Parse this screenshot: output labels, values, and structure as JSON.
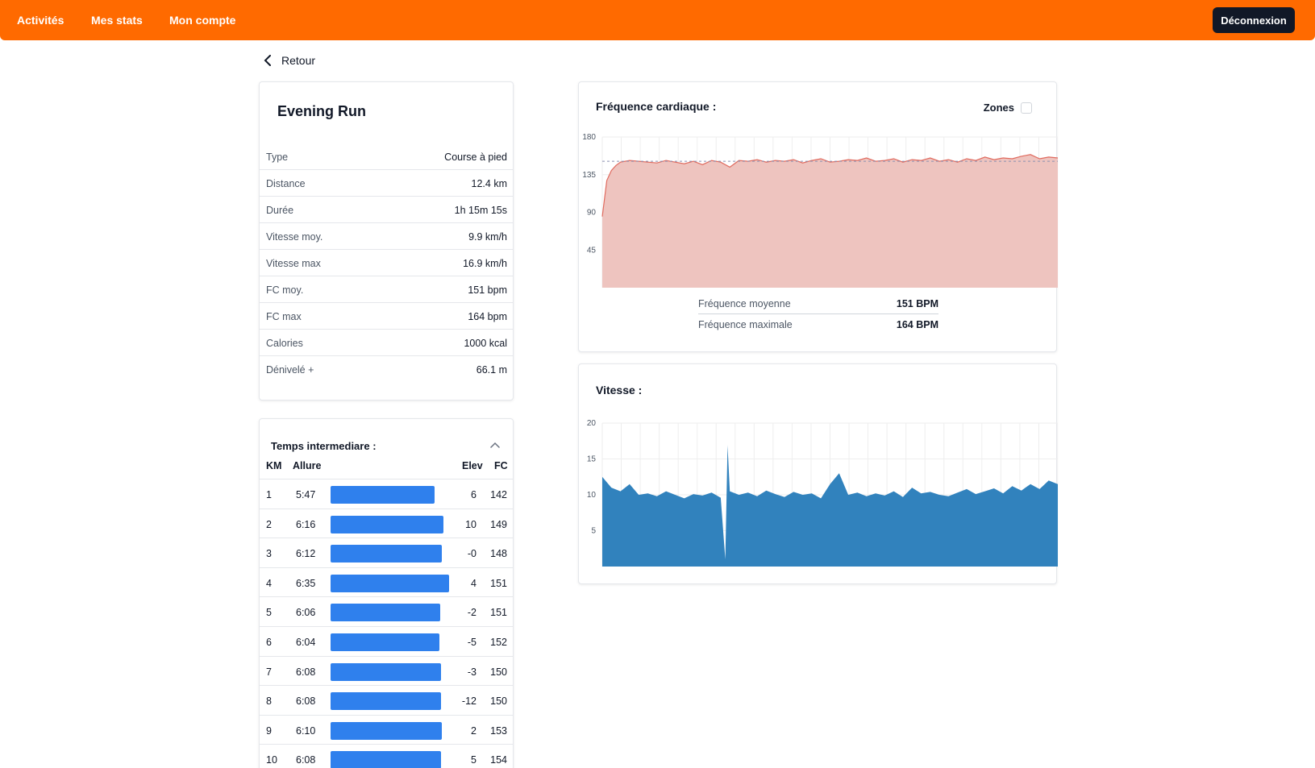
{
  "nav": {
    "links": [
      "Activités",
      "Mes stats",
      "Mon compte"
    ],
    "logout_label": "Déconnexion"
  },
  "back_label": "Retour",
  "activity": {
    "title": "Evening Run",
    "stats": [
      {
        "label": "Type",
        "value": "Course à pied"
      },
      {
        "label": "Distance",
        "value": "12.4 km"
      },
      {
        "label": "Durée",
        "value": "1h 15m 15s"
      },
      {
        "label": "Vitesse moy.",
        "value": "9.9 km/h"
      },
      {
        "label": "Vitesse max",
        "value": "16.9 km/h"
      },
      {
        "label": "FC moy.",
        "value": "151 bpm"
      },
      {
        "label": "FC max",
        "value": "164 bpm"
      },
      {
        "label": "Calories",
        "value": "1000 kcal"
      },
      {
        "label": "Dénivelé +",
        "value": "66.1 m"
      }
    ]
  },
  "splits": {
    "title": "Temps intermediare :",
    "headers": {
      "km": "KM",
      "pace": "Allure",
      "elev": "Elev",
      "hr": "FC"
    },
    "rows": [
      {
        "km": "1",
        "pace": "5:47",
        "elev": "6",
        "hr": "142",
        "pace_sec": 347
      },
      {
        "km": "2",
        "pace": "6:16",
        "elev": "10",
        "hr": "149",
        "pace_sec": 376
      },
      {
        "km": "3",
        "pace": "6:12",
        "elev": "-0",
        "hr": "148",
        "pace_sec": 372
      },
      {
        "km": "4",
        "pace": "6:35",
        "elev": "4",
        "hr": "151",
        "pace_sec": 395
      },
      {
        "km": "5",
        "pace": "6:06",
        "elev": "-2",
        "hr": "151",
        "pace_sec": 366
      },
      {
        "km": "6",
        "pace": "6:04",
        "elev": "-5",
        "hr": "152",
        "pace_sec": 364
      },
      {
        "km": "7",
        "pace": "6:08",
        "elev": "-3",
        "hr": "150",
        "pace_sec": 368
      },
      {
        "km": "8",
        "pace": "6:08",
        "elev": "-12",
        "hr": "150",
        "pace_sec": 368
      },
      {
        "km": "9",
        "pace": "6:10",
        "elev": "2",
        "hr": "153",
        "pace_sec": 370
      },
      {
        "km": "10",
        "pace": "6:08",
        "elev": "5",
        "hr": "154",
        "pace_sec": 368
      }
    ]
  },
  "heart_rate": {
    "title": "Fréquence cardiaque :",
    "zones_label": "Zones",
    "zones_checked": false,
    "avg_label": "Fréquence moyenne",
    "avg_value": "151 BPM",
    "max_label": "Fréquence maximale",
    "max_value": "164 BPM"
  },
  "speed": {
    "title": "Vitesse :"
  },
  "chart_data": [
    {
      "type": "area",
      "yticks": [
        45,
        90,
        135,
        180
      ],
      "ylim": [
        0,
        180
      ],
      "reference_line": 151,
      "x": [
        0,
        1,
        2,
        3,
        4,
        6,
        8,
        10,
        12,
        14,
        16,
        18,
        20,
        22,
        24,
        26,
        28,
        30,
        32,
        34,
        36,
        38,
        40,
        42,
        44,
        46,
        48,
        50,
        52,
        54,
        56,
        58,
        60,
        62,
        64,
        66,
        68,
        70,
        72,
        74,
        76,
        78,
        80,
        82,
        84,
        86,
        88,
        90,
        92,
        94,
        96,
        98,
        100
      ],
      "values": [
        85,
        128,
        140,
        146,
        150,
        152,
        151,
        150,
        149,
        152,
        150,
        148,
        151,
        147,
        152,
        150,
        144,
        152,
        151,
        153,
        150,
        152,
        151,
        153,
        149,
        152,
        154,
        150,
        151,
        153,
        152,
        155,
        151,
        152,
        154,
        150,
        153,
        152,
        155,
        151,
        153,
        150,
        154,
        152,
        156,
        153,
        155,
        154,
        157,
        159,
        154,
        156,
        155
      ],
      "color": "#e06b5f",
      "fill": "#eec4bf"
    },
    {
      "type": "area",
      "yticks": [
        5,
        10,
        15,
        20
      ],
      "ylim": [
        0,
        20
      ],
      "x": [
        0,
        2,
        4,
        6,
        8,
        10,
        12,
        14,
        16,
        18,
        20,
        22,
        24,
        26,
        27,
        27.5,
        28,
        30,
        32,
        34,
        36,
        38,
        40,
        42,
        44,
        46,
        48,
        50,
        52,
        54,
        56,
        58,
        60,
        62,
        64,
        66,
        68,
        70,
        72,
        74,
        76,
        78,
        80,
        82,
        84,
        86,
        88,
        90,
        92,
        94,
        96,
        98,
        100
      ],
      "values": [
        12.5,
        11,
        10.5,
        11.5,
        10,
        10.2,
        9.8,
        10.5,
        10,
        9.5,
        10.1,
        9.9,
        10.3,
        9.6,
        1,
        16.9,
        10.5,
        10,
        10.3,
        9.8,
        10.6,
        10.1,
        9.7,
        10.4,
        10,
        10.2,
        9.5,
        11.5,
        13,
        10,
        10.3,
        9.8,
        10.2,
        9.9,
        10.5,
        9.7,
        11,
        10.2,
        10.4,
        10,
        9.8,
        10.3,
        10.8,
        10.1,
        10.5,
        10.9,
        10.2,
        11.2,
        10.6,
        11.5,
        10.8,
        12,
        11.5
      ],
      "color": "#3182bd"
    }
  ]
}
